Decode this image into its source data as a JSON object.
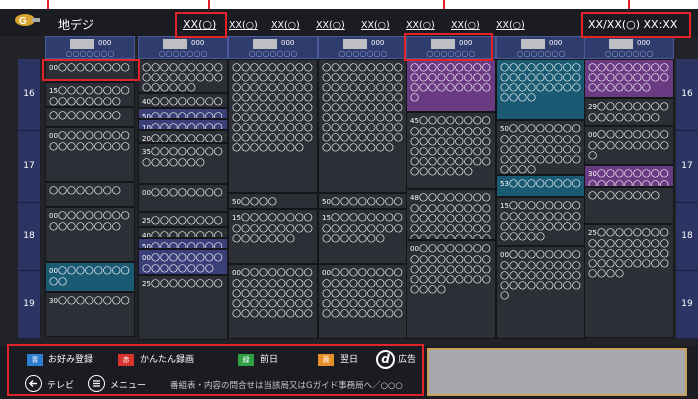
{
  "header": {
    "channel_type": "地デジ",
    "selected_date": "XX(○)",
    "dates": [
      "XX(○)",
      "XX(○)",
      "XX(○)",
      "XX(○)",
      "XX(○)",
      "XX(○)",
      "XX(○)"
    ],
    "clock": "XX/XX(○) XX:XX"
  },
  "channels": [
    {
      "num": "000",
      "name": "○○○○○○○"
    },
    {
      "num": "000",
      "name": "○○○○○○○"
    },
    {
      "num": "000",
      "name": "○○○○○○○"
    },
    {
      "num": "000",
      "name": "○○○○○○○"
    },
    {
      "num": "000",
      "name": "○○○○○○○"
    },
    {
      "num": "000",
      "name": "○○○○○○○"
    },
    {
      "num": "000",
      "name": "○○○○○○○"
    }
  ],
  "hours": [
    "16",
    "17",
    "18",
    "19"
  ],
  "programs": [
    [
      {
        "min": "00",
        "title": "○○○○○○○○",
        "color": "default"
      },
      {
        "min": "15",
        "title": "○○○○○○○○○○○○○○○○",
        "color": "default"
      },
      {
        "min": "",
        "title": "○○○○○○○○",
        "color": "default"
      },
      {
        "min": "00",
        "title": "○○○○○○○○○○○○○○○○○",
        "color": "default"
      },
      {
        "min": "",
        "title": "○○○○○○○○",
        "color": "default"
      },
      {
        "min": "00",
        "title": "○○○○○○○○○○○○○○○○",
        "color": "default"
      },
      {
        "min": "00",
        "title": "○○○○○○○○○○",
        "color": "teal"
      },
      {
        "min": "30",
        "title": "○○○○○○○○",
        "color": "default"
      }
    ],
    [
      {
        "min": "",
        "title": "○○○○○○○○○○○○○○○○○○○○○○○○",
        "color": "default"
      },
      {
        "min": "40",
        "title": "○○○○○○○○",
        "color": "default"
      },
      {
        "min": "50",
        "title": "○○○○○○○○",
        "color": "blue"
      },
      {
        "min": "10",
        "title": "○○○○○○○○",
        "color": "blue"
      },
      {
        "min": "20",
        "title": "○○○○○○○○",
        "color": "default"
      },
      {
        "min": "35",
        "title": "○○○○○○○○○○○○○○○",
        "color": "default"
      },
      {
        "min": "00",
        "title": "○○○○○○○○",
        "color": "default"
      },
      {
        "min": "25",
        "title": "○○○○○○○○",
        "color": "default"
      },
      {
        "min": "40",
        "title": "○○○○○○○○",
        "color": "default"
      },
      {
        "min": "50",
        "title": "○○○○○○○○",
        "color": "blue"
      },
      {
        "min": "00",
        "title": "○○○○○○○○○○○○○○○○",
        "color": "blue"
      },
      {
        "min": "25",
        "title": "○○○○○○○○",
        "color": "default"
      }
    ],
    [
      {
        "min": "",
        "title": "○○○○○○○○○○○○○○○○○○○○○○○○○○○○○○○○○○○○○○○○○○○○○○○○○○○○○○○○○○○○○○○○○○○○○○○○○○○○○○○○",
        "color": "default"
      },
      {
        "min": "50",
        "title": "○○○○",
        "color": "default"
      },
      {
        "min": "15",
        "title": "○○○○○○○○○○○○○○○○○○○○○○○○",
        "color": "default"
      },
      {
        "min": "00",
        "title": "○○○○○○○○○○○○○○○○○○○○○○○○○○○○○○○○○○○○○○○○○○○○",
        "color": "default"
      }
    ],
    [
      {
        "min": "",
        "title": "○○○○○○○○○○○○○○○○○○○○○○○○○○○○○○○○○○○○○○○○○○○○○○○○○○○○○○○○○○○○○○○○○○○○○○○○○○○○○○○○",
        "color": "default"
      },
      {
        "min": "50",
        "title": "○○○○○○○○○○○○○○",
        "color": "default"
      },
      {
        "min": "15",
        "title": "○○○○○○○○○○○○○○○○○○○○○○○○",
        "color": "default"
      },
      {
        "min": "00",
        "title": "○○○○○○○○○○○○○○○○○○○○○○○○○○○○○○○○○○○○○○○○○○○○",
        "color": "default"
      }
    ],
    [
      {
        "min": "",
        "title": "○○○○○○○○○○○○○○○○○○○○○○○○○○○○",
        "color": "purple"
      },
      {
        "min": "45",
        "title": "○○○○○○○○○○○○○○○○○○○○○○○○○○○○○○○○○○○○○○○○○○○○○○○○○○○",
        "color": "default"
      },
      {
        "min": "48",
        "title": "○○○○○○○○○○○○○○○○○○○○○○○○○○○○○○○○○○○○○○○○○○○○○○○○○○○",
        "color": "default"
      },
      {
        "min": "00",
        "title": "○○○○○○○○○○○○○○○○○○○○○○○○○○○○○○○○○○○○○○○",
        "color": "default"
      }
    ],
    [
      {
        "min": "",
        "title": "○○○○○○○○○○○○○○○○○○○○○○○○○○○○○○○",
        "color": "teal"
      },
      {
        "min": "50",
        "title": "○○○○○○○○○○○○○○○○○○○○○○○○○○○○○○○○○○○○○○○",
        "color": "default"
      },
      {
        "min": "53",
        "title": "○○○○○○○○",
        "color": "teal"
      },
      {
        "min": "15",
        "title": "○○○○○○○○○○○○○○○○○○○○○○○○○○○○○○○",
        "color": "default"
      },
      {
        "min": "00",
        "title": "○○○○○○○○○○○○○○○○○○○○○○○○○○○○○○○○○○○○",
        "color": "default"
      }
    ],
    [
      {
        "min": "",
        "title": "○○○○○○○○○○○○○○○○○○○○○○○○○",
        "color": "purple"
      },
      {
        "min": "29",
        "title": "○○○○○○○○○○○○○○○○",
        "color": "default"
      },
      {
        "min": "00",
        "title": "○○○○○○○○○○○○○○○○○○",
        "color": "default"
      },
      {
        "min": "30",
        "title": "○○○○○○○○○○○○○○○○○○○○○○",
        "color": "purple"
      },
      {
        "min": "",
        "title": "○○○○○○○○",
        "color": "default"
      },
      {
        "min": "25",
        "title": "○○○○○○○○○○○○○○○○○○○○○○○○○○○○○○○○○○○○○○○",
        "color": "default"
      }
    ]
  ],
  "footer": {
    "blue_key": "青",
    "blue_label": "お好み登録",
    "red_key": "赤",
    "red_label": "かんたん録画",
    "green_key": "緑",
    "green_label": "前日",
    "yellow_key": "黄",
    "yellow_label": "翌日",
    "d_key": "d",
    "d_label": "広告",
    "back_label": "テレビ",
    "menu_label": "メニュー",
    "note": "番組表・内容の問合せは当該局又はGガイド事務局へ／○○○"
  },
  "colors": {
    "accent": "#e2232a",
    "blue": "#2d7fd1",
    "red": "#d8312f",
    "green": "#2ea043",
    "yellow": "#e6902a",
    "purple": "#6a3a82",
    "teal": "#1a5a72"
  }
}
